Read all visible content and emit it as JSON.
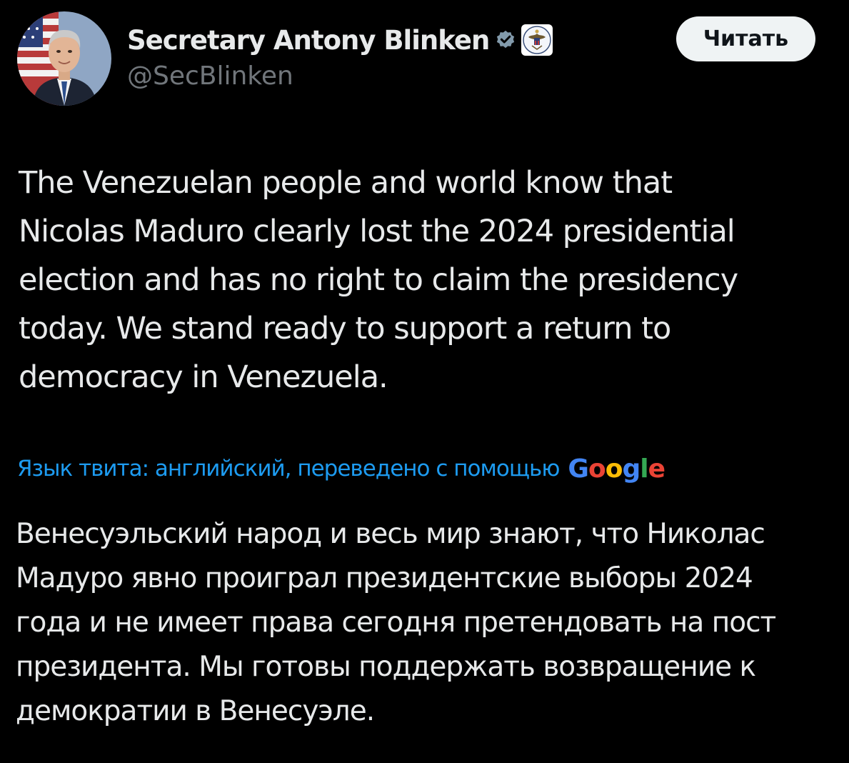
{
  "author": {
    "display_name": "Secretary Antony Blinken",
    "handle": "@SecBlinken",
    "verified_icon": "verified-badge-icon",
    "affiliation_icon": "us-state-department-seal-icon",
    "follow_button_label": "Читать"
  },
  "tweet": {
    "text_lines": [
      "The Venezuelan people and world know that",
      "Nicolas Maduro clearly lost the 2024 presidential",
      "election and has no right to claim the presidency",
      "today. We stand ready to support a return to",
      "democracy in Venezuela."
    ]
  },
  "translation": {
    "label": "Язык твита: английский, переведено с помощью",
    "provider": "Google",
    "provider_colors": [
      "#4285f4",
      "#ea4335",
      "#fbbc05",
      "#4285f4",
      "#34a853",
      "#ea4335"
    ],
    "text_lines": [
      "Венесуэльский народ и весь мир знают, что Николас",
      "Мадуро явно проиграл президентские выборы 2024",
      "года и не имеет права сегодня претендовать на пост",
      "президента. Мы готовы поддержать возвращение к",
      "демократии в Венесуэле."
    ]
  },
  "colors": {
    "background": "#000000",
    "text_primary": "#e7e9ea",
    "text_secondary": "#71767b",
    "link": "#1d9bf0",
    "button_bg": "#eff3f4"
  }
}
